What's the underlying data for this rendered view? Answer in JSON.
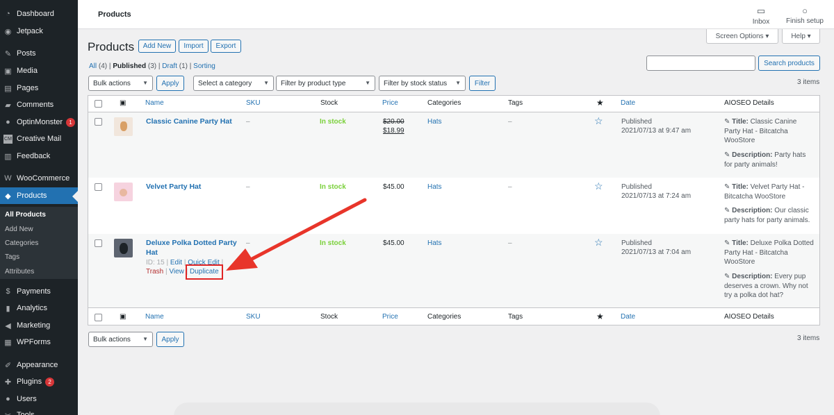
{
  "sidebar": {
    "items": [
      {
        "label": "Dashboard",
        "icon": "dashboard-icon",
        "glyph": "◔"
      },
      {
        "label": "Jetpack",
        "icon": "jetpack-icon",
        "glyph": "◉"
      },
      {
        "label": "Posts",
        "icon": "pin-icon",
        "glyph": "✎"
      },
      {
        "label": "Media",
        "icon": "media-icon",
        "glyph": "▣"
      },
      {
        "label": "Pages",
        "icon": "pages-icon",
        "glyph": "▤"
      },
      {
        "label": "Comments",
        "icon": "comments-icon",
        "glyph": "▰"
      },
      {
        "label": "OptinMonster",
        "icon": "optinmonster-icon",
        "glyph": "●",
        "badge": "1"
      },
      {
        "label": "Creative Mail",
        "icon": "creative-mail-icon",
        "glyph": "CM"
      },
      {
        "label": "Feedback",
        "icon": "feedback-icon",
        "glyph": "▥"
      },
      {
        "label": "WooCommerce",
        "icon": "woocommerce-icon",
        "glyph": "W"
      },
      {
        "label": "Products",
        "icon": "products-icon",
        "glyph": "◆"
      },
      {
        "label": "Payments",
        "icon": "payments-icon",
        "glyph": "$"
      },
      {
        "label": "Analytics",
        "icon": "analytics-icon",
        "glyph": "▮"
      },
      {
        "label": "Marketing",
        "icon": "marketing-icon",
        "glyph": "◀"
      },
      {
        "label": "WPForms",
        "icon": "wpforms-icon",
        "glyph": "▦"
      },
      {
        "label": "Appearance",
        "icon": "appearance-icon",
        "glyph": "✐"
      },
      {
        "label": "Plugins",
        "icon": "plugins-icon",
        "glyph": "✚",
        "badge": "2"
      },
      {
        "label": "Users",
        "icon": "users-icon",
        "glyph": "●"
      },
      {
        "label": "Tools",
        "icon": "tools-icon",
        "glyph": "✂"
      }
    ],
    "submenu": [
      "All Products",
      "Add New",
      "Categories",
      "Tags",
      "Attributes"
    ]
  },
  "topbar": {
    "title": "Products",
    "inbox_label": "Inbox",
    "finish_setup_label": "Finish setup",
    "screen_options_label": "Screen Options ▾",
    "help_label": "Help ▾"
  },
  "page": {
    "title": "Products",
    "add_new": "Add New",
    "import": "Import",
    "export": "Export"
  },
  "filters": {
    "all": "All",
    "all_count": "(4)",
    "published": "Published",
    "published_count": "(3)",
    "draft": "Draft",
    "draft_count": "(1)",
    "sorting": "Sorting",
    "sep": "|"
  },
  "search": {
    "value": "",
    "button": "Search products"
  },
  "toolbar": {
    "bulk_actions": "Bulk actions",
    "apply": "Apply",
    "category": "Select a category",
    "product_type": "Filter by product type",
    "stock_status": "Filter by stock status",
    "filter": "Filter",
    "items_count": "3 items"
  },
  "table": {
    "headers": {
      "name": "Name",
      "sku": "SKU",
      "stock": "Stock",
      "price": "Price",
      "categories": "Categories",
      "tags": "Tags",
      "date": "Date",
      "aioseo": "AIOSEO Details"
    },
    "rows": [
      {
        "name": "Classic Canine Party Hat",
        "sku": "–",
        "stock": "In stock",
        "price_old": "$20.00",
        "price_new": "$18.99",
        "category": "Hats",
        "tags": "–",
        "date_status": "Published",
        "date_value": "2021/07/13 at 9:47 am",
        "seo_title_label": "Title:",
        "seo_title": "Classic Canine Party Hat - Bitcatcha WooStore",
        "seo_desc_label": "Description:",
        "seo_desc": "Party hats for party animals!"
      },
      {
        "name": "Velvet Party Hat",
        "sku": "–",
        "stock": "In stock",
        "price": "$45.00",
        "category": "Hats",
        "tags": "–",
        "date_status": "Published",
        "date_value": "2021/07/13 at 7:24 am",
        "seo_title_label": "Title:",
        "seo_title": "Velvet Party Hat - Bitcatcha WooStore",
        "seo_desc_label": "Description:",
        "seo_desc": "Our classic party hats for party animals."
      },
      {
        "name_line1": "Deluxe Polka Dotted Party",
        "name_line2": "Hat",
        "id_text": "ID: 15",
        "edit": "Edit",
        "quick_edit": "Quick Edit",
        "trash": "Trash",
        "view": "View",
        "duplicate": "Duplicate",
        "sku": "–",
        "stock": "In stock",
        "price": "$45.00",
        "category": "Hats",
        "tags": "–",
        "date_status": "Published",
        "date_value": "2021/07/13 at 7:04 am",
        "seo_title_label": "Title:",
        "seo_title": "Deluxe Polka Dotted Party Hat - Bitcatcha WooStore",
        "seo_desc_label": "Description:",
        "seo_desc": "Every pup deserves a crown. Why not try a polka dot hat?"
      }
    ]
  },
  "colors": {
    "accent": "#2271b1",
    "in_stock": "#7ad03a",
    "highlight": "#e02424",
    "sidebar_bg": "#1d2327"
  }
}
